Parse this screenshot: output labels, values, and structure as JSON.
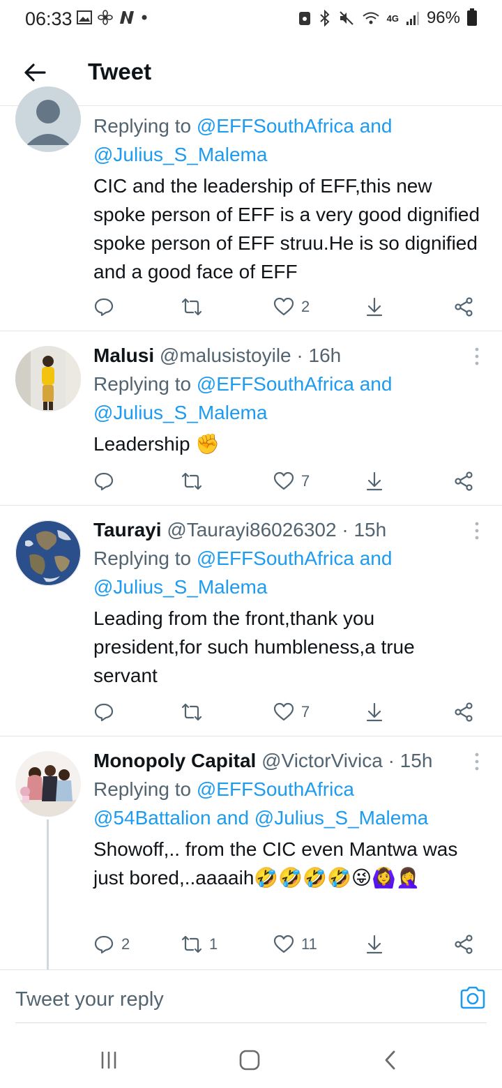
{
  "status_bar": {
    "time": "06:33",
    "network": "4G",
    "battery": "96%"
  },
  "header": {
    "title": "Tweet"
  },
  "tweets": [
    {
      "name": "",
      "handle": "",
      "time": "",
      "reply_prefix": "Replying to",
      "mentions_line1": "@EFFSouthAfrica and",
      "mentions_line2": "@Julius_S_Malema",
      "text": "CIC and the leadership of EFF,this new spoke person of EFF is a very good dignified spoke person  of EFF struu.He is so dignified and a good face of EFF",
      "replies": "",
      "retweets": "",
      "likes": "2"
    },
    {
      "name": "Malusi",
      "handle": "@malusistoyile",
      "time": "· 16h",
      "reply_prefix": "Replying to",
      "mentions_line1": "@EFFSouthAfrica and",
      "mentions_line2": "@Julius_S_Malema",
      "text": "Leadership ✊",
      "replies": "",
      "retweets": "",
      "likes": "7"
    },
    {
      "name": "Taurayi",
      "handle": "@Taurayi86026302",
      "time": "· 15h",
      "reply_prefix": "Replying to",
      "mentions_line1": "@EFFSouthAfrica and",
      "mentions_line2": "@Julius_S_Malema",
      "text": "Leading from the front,thank you president,for such humbleness,a true servant",
      "replies": "",
      "retweets": "",
      "likes": "7"
    },
    {
      "name": "Monopoly Capital",
      "handle": "@VictorVivica",
      "time": "· 15h",
      "reply_prefix": "Replying to",
      "mentions_line1": "@EFFSouthAfrica",
      "mentions_line2": "@54Battalion and @Julius_S_Malema",
      "text": "Showoff,.. from the CIC even Mantwa was just bored,..aaaaih🤣🤣🤣🤣😜🙆‍♀️🤦‍♀️",
      "replies": "2",
      "retweets": "1",
      "likes": "11"
    }
  ],
  "reply_bar": {
    "placeholder": "Tweet your reply"
  },
  "colors": {
    "accent": "#1d9bf0",
    "text": "#0f1419",
    "muted": "#536471",
    "divider": "#e1e4e8"
  }
}
